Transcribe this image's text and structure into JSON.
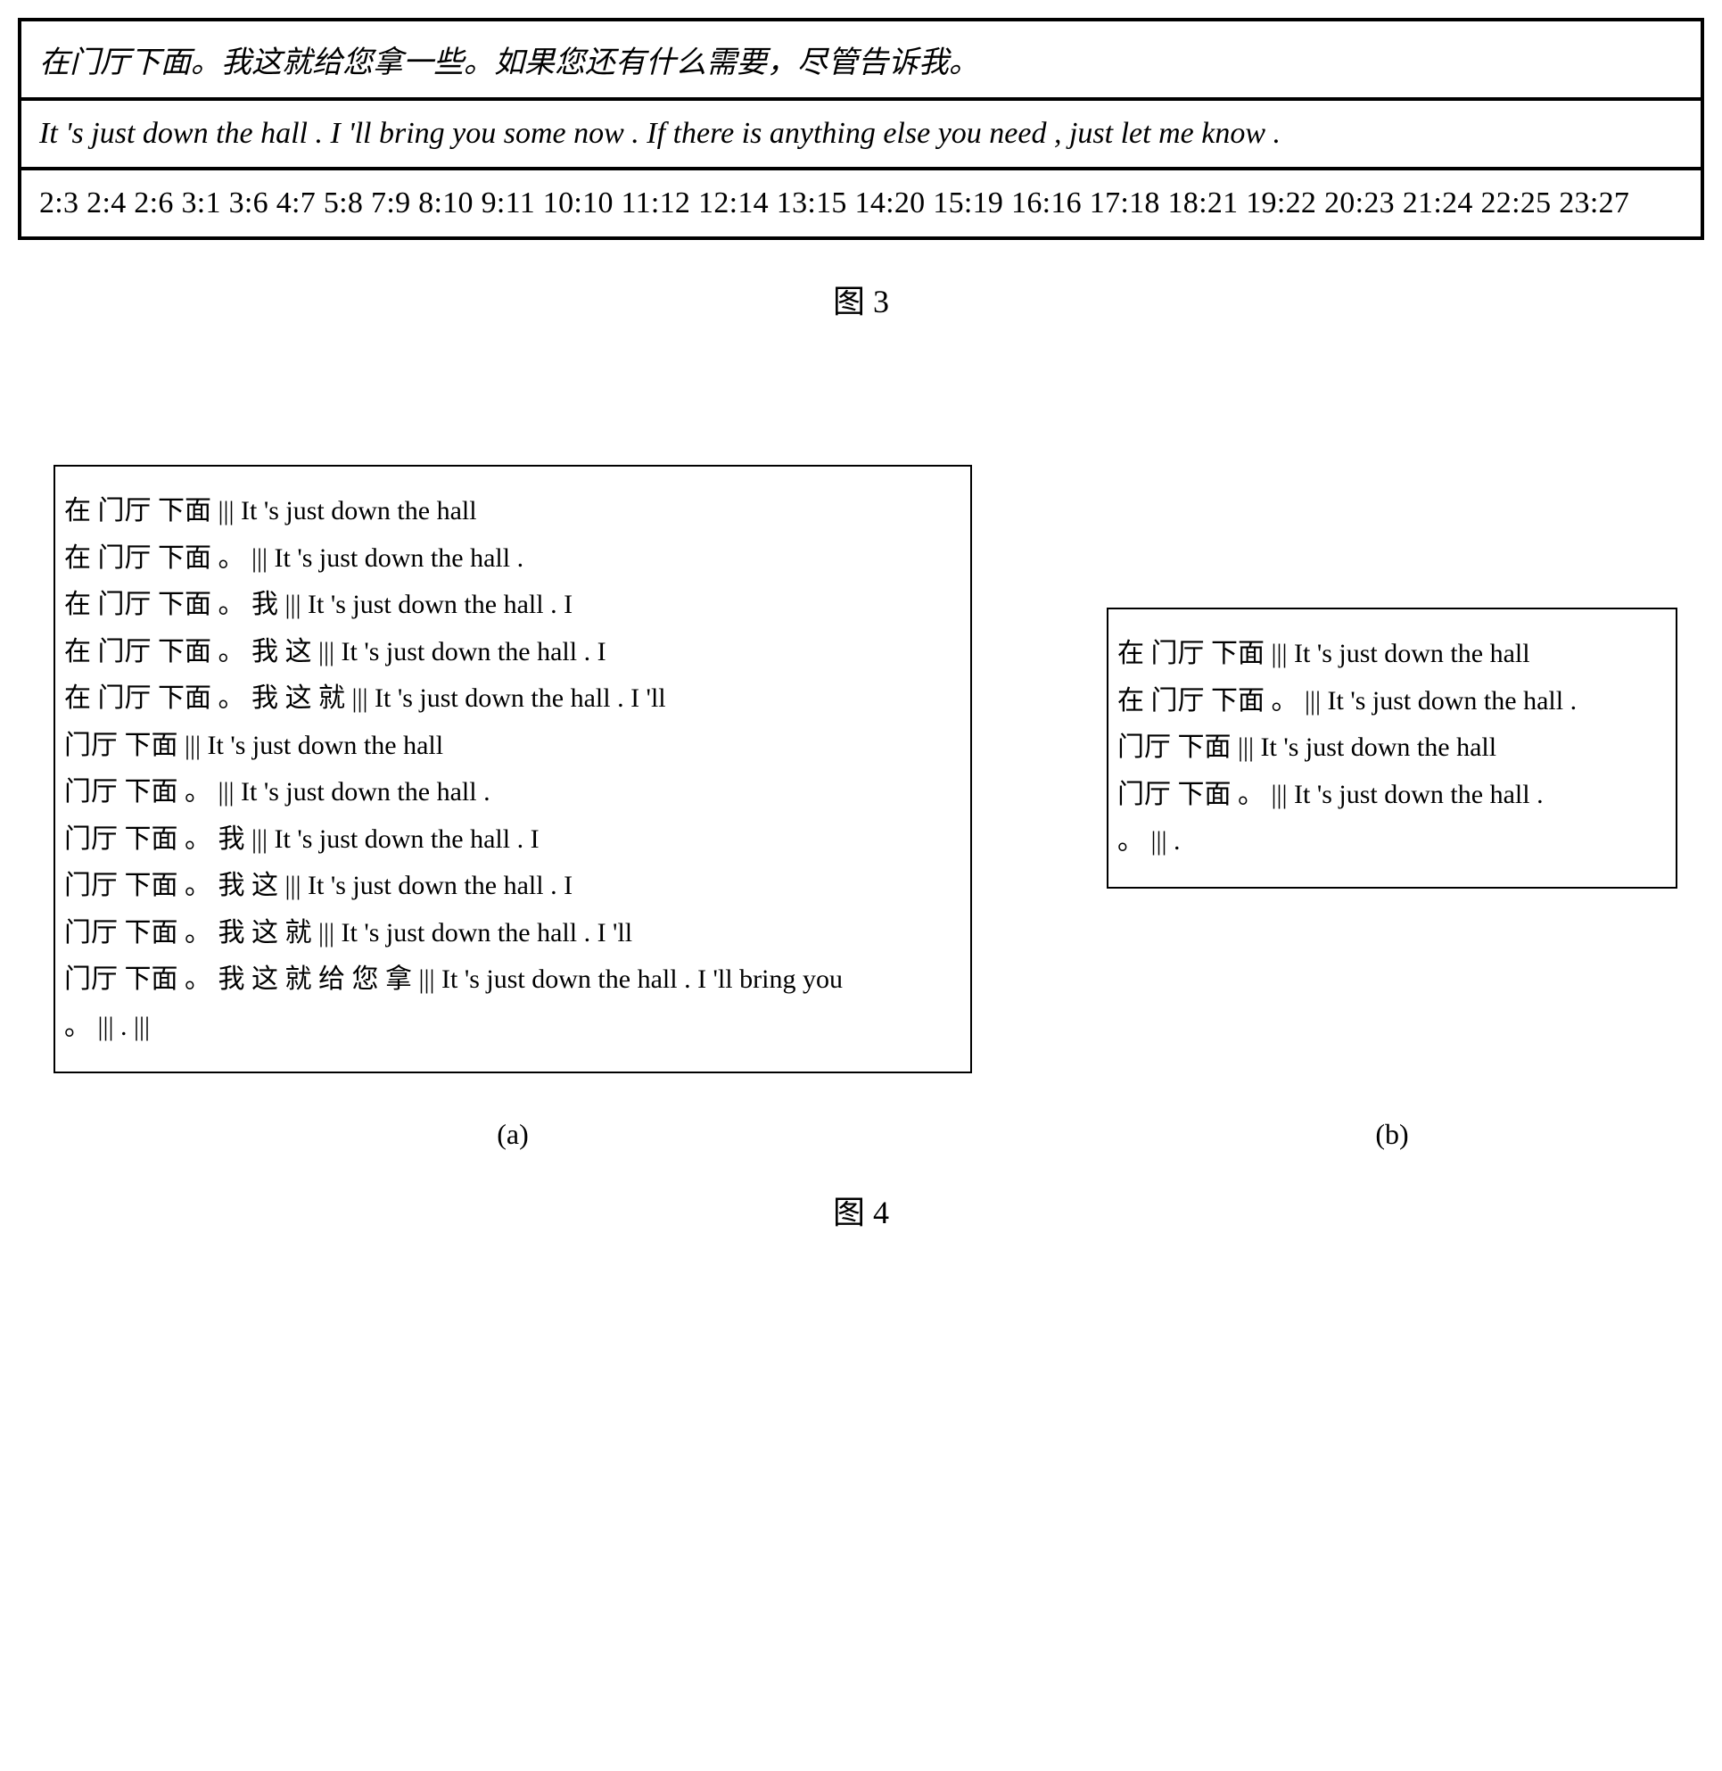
{
  "figure3": {
    "row_cn": "在门厅下面。我这就给您拿一些。如果您还有什么需要，尽管告诉我。",
    "row_en": "It 's just down the hall . I 'll bring you some now . If there is anything else you need , just let me know .",
    "row_align": "2:3 2:4 2:6 3:1 3:6 4:7 5:8 7:9 8:10 9:11 10:10 11:12 12:14 13:15 14:20 15:19 16:16 17:18 18:21 19:22 20:23 21:24 22:25 23:27",
    "label": "图 3"
  },
  "figure4": {
    "box_a_lines": [
      "在 门厅 下面 ||| It 's just down the hall",
      "在 门厅 下面 。 ||| It 's just down the hall .",
      "在 门厅 下面 。 我 ||| It 's just down the hall . I",
      "在 门厅 下面 。 我 这 ||| It 's just down the hall . I",
      "在 门厅 下面 。 我 这 就 ||| It 's just down the hall . I 'll",
      "门厅 下面 ||| It 's just down the hall",
      "门厅 下面 。 ||| It 's just down the hall .",
      "门厅 下面 。 我 ||| It 's just down the hall . I",
      "门厅 下面 。 我 这 ||| It 's just down the hall . I",
      "门厅 下面 。 我 这 就 ||| It 's just down the hall . I 'll",
      "门厅 下面 。 我 这 就 给 您 拿 ||| It 's just down the hall . I 'll bring you",
      "。 ||| . |||"
    ],
    "box_b_lines": [
      "在 门厅 下面 ||| It 's just down the hall",
      "在 门厅 下面 。 ||| It 's just down the hall .",
      "门厅 下面 ||| It 's just down the hall",
      "门厅 下面 。 ||| It 's just down the hall .",
      "。 ||| ."
    ],
    "sub_a": "(a)",
    "sub_b": "(b)",
    "label": "图 4"
  }
}
